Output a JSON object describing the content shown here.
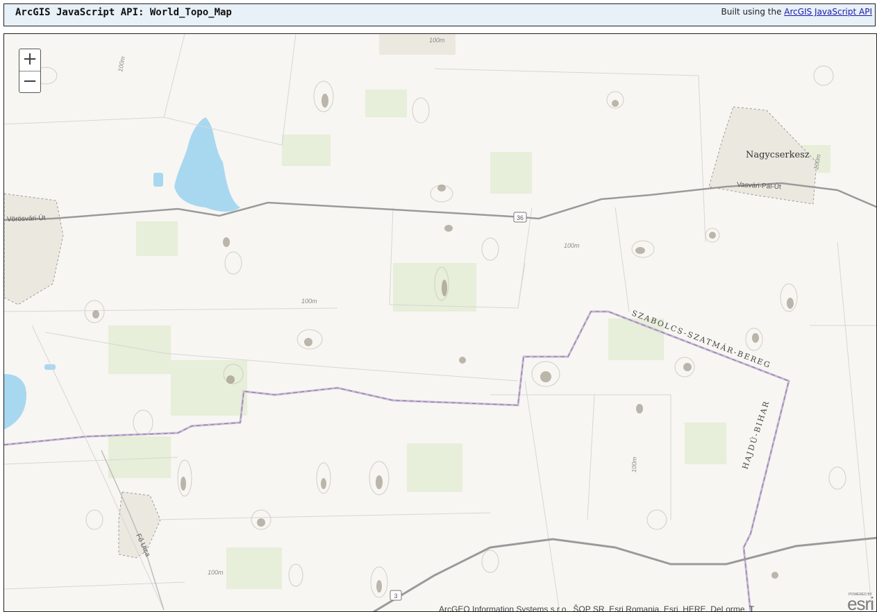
{
  "header": {
    "title": "ArcGIS JavaScript API: World_Topo_Map",
    "built_prefix": "Built using the ",
    "built_link": "ArcGIS JavaScript API"
  },
  "map": {
    "zoom_in": "+",
    "zoom_out": "−",
    "labels": {
      "town_nagycserkesz": "Nagycserkesz",
      "road_vasvari": "Vasvári-Pál-Út",
      "road_vorosvari": "Vörösvári-Út",
      "road_fo_utca": "Fő Utca",
      "shield_36": "36",
      "shield_3": "3",
      "region_szabolcs": "SZABOLCS-SZATMÁR-BEREG",
      "region_hajdu": "HAJDÚ-BIHAR",
      "contour": "100m"
    },
    "attribution": "ArcGEO Information Systems s.r.o., ŠOP SR, Esri Romania, Esri, HERE, DeLorme, T",
    "powered_by": "POWERED BY",
    "esri_logo": "esri",
    "colors": {
      "water": "#a8d8f0",
      "background": "#f7f6f2",
      "vegetation": "#e4ecd4",
      "road": "#9a9a9a",
      "boundary": "#b8a8c8"
    }
  }
}
